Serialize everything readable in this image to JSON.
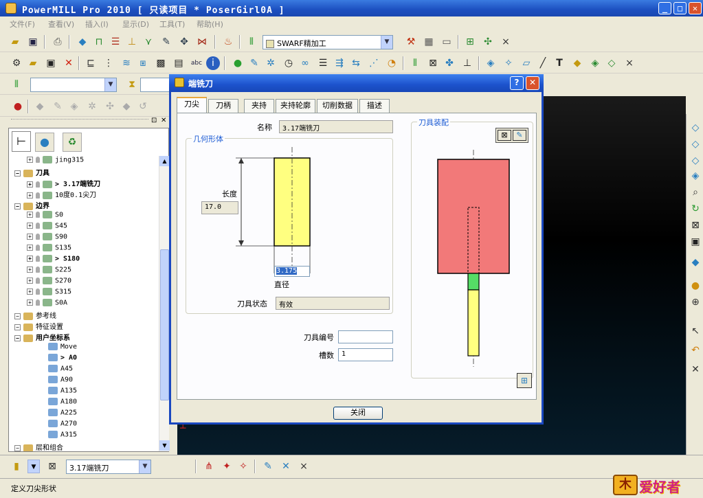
{
  "app": {
    "title_text": "PowerMILL Pro 2010      [ 只读项目 * PoserGirl0A ]"
  },
  "window_buttons": {
    "minimize": "_",
    "maximize": "□",
    "close": "✕"
  },
  "menu": [
    "文件(F)",
    "查看(V)",
    "插入(I)",
    "显示(D)",
    "工具(T)",
    "帮助(H)"
  ],
  "toolbar1": {
    "strategy_combo": "SWARF精加工",
    "close": "×"
  },
  "toolbar2": {
    "close": "×"
  },
  "toolbar3": {
    "combo_value": ""
  },
  "explorer": {
    "rows": [
      {
        "label": "jing315",
        "indent": 1,
        "bold": false
      },
      {
        "label": "刀具",
        "indent": 0,
        "bold": true
      },
      {
        "label": "> 3.17端铣刀",
        "indent": 1,
        "bold": true
      },
      {
        "label": "10度0.1尖刀",
        "indent": 1,
        "bold": false
      },
      {
        "label": "边界",
        "indent": 0,
        "bold": true
      },
      {
        "label": "S0",
        "indent": 1,
        "bold": false
      },
      {
        "label": "S45",
        "indent": 1,
        "bold": false
      },
      {
        "label": "S90",
        "indent": 1,
        "bold": false
      },
      {
        "label": "S135",
        "indent": 1,
        "bold": false
      },
      {
        "label": "> S180",
        "indent": 1,
        "bold": true
      },
      {
        "label": "S225",
        "indent": 1,
        "bold": false
      },
      {
        "label": "S270",
        "indent": 1,
        "bold": false
      },
      {
        "label": "S315",
        "indent": 1,
        "bold": false
      },
      {
        "label": "S0A",
        "indent": 1,
        "bold": false
      },
      {
        "label": "参考线",
        "indent": 0,
        "bold": false
      },
      {
        "label": "特征设置",
        "indent": 0,
        "bold": false
      },
      {
        "label": "用户坐标系",
        "indent": 0,
        "bold": true
      },
      {
        "label": "Move",
        "indent": 2,
        "bold": false
      },
      {
        "label": "> A0",
        "indent": 2,
        "bold": true
      },
      {
        "label": "A45",
        "indent": 2,
        "bold": false
      },
      {
        "label": "A90",
        "indent": 2,
        "bold": false
      },
      {
        "label": "A135",
        "indent": 2,
        "bold": false
      },
      {
        "label": "A180",
        "indent": 2,
        "bold": false
      },
      {
        "label": "A225",
        "indent": 2,
        "bold": false
      },
      {
        "label": "A270",
        "indent": 2,
        "bold": false
      },
      {
        "label": "A315",
        "indent": 2,
        "bold": false
      },
      {
        "label": "层和组合",
        "indent": 0,
        "bold": false
      }
    ]
  },
  "dialog": {
    "title": "端铣刀",
    "help": "?",
    "close_x": "✕",
    "tabs": [
      "刀尖",
      "刀柄",
      "夹持",
      "夹持轮廓",
      "切削数据",
      "描述"
    ],
    "name_label": "名称",
    "name_value": "3.17端铣刀",
    "geometry_group": "几何形体",
    "length_label": "长度",
    "length_value": "17.0",
    "diameter_value": "3.175",
    "diameter_label": "直径",
    "state_label": "刀具状态",
    "state_value": "有效",
    "assembly_group": "刀具装配",
    "tool_number_label": "刀具编号",
    "tool_number_value": "",
    "flutes_label": "槽数",
    "flutes_value": "1",
    "close_button": "关闭"
  },
  "bottom": {
    "tool_combo": "3.17端铣刀",
    "close": "×"
  },
  "status": {
    "text": "定义刀尖形状"
  },
  "watermark": {
    "text": "爱好者"
  },
  "colors": {
    "holder": "#f27979",
    "shank": "#ffff80",
    "tip": "#55dd66",
    "tool": "#ffff80"
  }
}
